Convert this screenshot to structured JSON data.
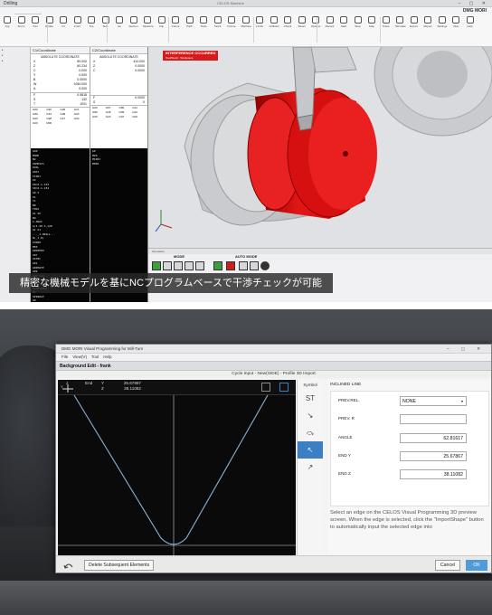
{
  "top": {
    "title": "Drilling",
    "caption_window": "CELOS Machine",
    "tabs": [
      "FILE",
      "CONTROL",
      "PROGRAM",
      "MACHINE",
      "TOOLS"
    ],
    "brand": "DMG MORI",
    "ribbon_labels": [
      "Jog",
      "Zoom",
      "Pan",
      "Rotate",
      "Fit",
      "Front",
      "Top",
      "Side",
      "Iso",
      "Section",
      "Measure",
      "Clip",
      "Colors",
      "Path",
      "Tools",
      "Stock",
      "Fixture",
      "Machine",
      "Limits",
      "Collision",
      "Check",
      "Reset",
      "Options",
      "Record",
      "Start",
      "Stop",
      "Step",
      "Trace",
      "Simulate",
      "Export",
      "Report",
      "Settings",
      "View",
      "Help"
    ],
    "channel1_header": "C1/Coordinate",
    "channel1_sub": "ABSOLUTE COORDINATE",
    "channel2_header": "C2/Coordinate",
    "channel2_sub": "ABSOLUTE COORDINATE",
    "ch1_coords": [
      {
        "axis": "X",
        "value": "80.000"
      },
      {
        "axis": "Z",
        "value": "60.234"
      },
      {
        "axis": "C",
        "value": "0.000"
      },
      {
        "axis": "Y",
        "value": "0.000"
      },
      {
        "axis": "B",
        "value": "0.0000"
      },
      {
        "axis": "W",
        "value": "1050.000"
      },
      {
        "axis": "A",
        "value": "0.000"
      }
    ],
    "ch2_coords": [
      {
        "axis": "X",
        "value": "410.000"
      },
      {
        "axis": "Z",
        "value": "0.0000"
      },
      {
        "axis": "C",
        "value": "0.0000"
      }
    ],
    "ch1_feed": [
      {
        "k": "F",
        "v": "0.5818"
      },
      {
        "k": "S",
        "v": "132"
      },
      {
        "k": "T",
        "v": "1001"
      }
    ],
    "ch2_feed": [
      {
        "k": "F",
        "v": "0.0000"
      },
      {
        "k": "S",
        "v": "0"
      }
    ],
    "ch1_grid": [
      [
        "G00",
        "G90",
        "G00",
        "G21"
      ],
      [
        "G80",
        "G23",
        "G99",
        "G00"
      ],
      [
        "G00",
        "G98",
        "G17",
        "G00"
      ],
      [
        "G00",
        "M00",
        "",
        ""
      ]
    ],
    "ch2_grid": [
      [
        "G00",
        "G97",
        "G80",
        "G21"
      ],
      [
        "G80",
        "G28",
        "G99",
        "G22"
      ],
      [
        "G00",
        "G23",
        "G97",
        "G00"
      ]
    ],
    "ch1_program": [
      "G40",
      "MODE",
      "N2",
      "OSMOSIS",
      "OVAL",
      "G0A7",
      "T1001",
      "Z2",
      "S0=Z-1.234",
      "S0=Z-1.234",
      "G0 X",
      "X1",
      "Y1",
      "N0",
      "T001",
      "G1 SP",
      "N9",
      "I.ANAI",
      "G/I.20 S,120",
      "G1 X1",
      "..._1.DRILL...",
      "N(_1,0)",
      "S3000",
      "M50",
      "G00ZERO",
      "G97",
      "ASYNC",
      "G01",
      "ANIMATE",
      "G99",
      "G00 G22",
      "N199",
      "N09",
      "MAINTMODE",
      "M5",
      "SPINDLE",
      "G0",
      "OSFSTENA",
      "NX",
      "SPEED",
      "NX",
      "INTERFERENCE",
      "M30"
    ],
    "ch2_program": [
      "G0",
      "M20",
      "M1002",
      "M000"
    ],
    "alarm_title": "INTERFERENCE OCCURRED",
    "alarm_detail": "Tool/Stock : Workpiece",
    "bottom_tab": "Simulation",
    "mode_label": "MODE",
    "auto_mode_label": "AUTO MODE",
    "subtitle": "精密な機械モデルを基にNCプログラムベースで干渉チェックが可能"
  },
  "bottom": {
    "window_title": "DMG MORI Visual Programming for Mill-Turn",
    "menu": [
      "File",
      "View(V)",
      "Tool",
      "Help"
    ],
    "sub_title": "Background Edit - frank",
    "cycle_title": "Cycle Input - New(SIDE) - Profile 3D Import",
    "readout": [
      {
        "a": "End",
        "b": "Y",
        "c": "25.67867"
      },
      {
        "a": "",
        "b": "Z",
        "c": "38.11082"
      }
    ],
    "axis_z": "Z",
    "axis_y": "Y",
    "symbol_header": "Symbol",
    "symbols": [
      "ST",
      "↘",
      "⤼",
      "↖",
      "↗"
    ],
    "form_header": "INCLINED LINE",
    "fields": [
      {
        "label": "PREV.REL.",
        "value": "NONE",
        "type": "select"
      },
      {
        "label": "PREV. R",
        "value": "",
        "type": "text"
      },
      {
        "label": "ANGLE",
        "value": "62.81617",
        "type": "text"
      },
      {
        "label": "END Y",
        "value": "25.67867",
        "type": "text"
      },
      {
        "label": "END Z",
        "value": "38.11082",
        "type": "text"
      }
    ],
    "help_text": "Select an edge on the CELOS Visual Programming 3D preview screen. When the edge is selected, click the \"ImportShape\" button to automatically input the selected edge into",
    "delete_button": "Delete Subsequent Elements",
    "cancel_button": "Cancel",
    "ok_button": "OK"
  }
}
